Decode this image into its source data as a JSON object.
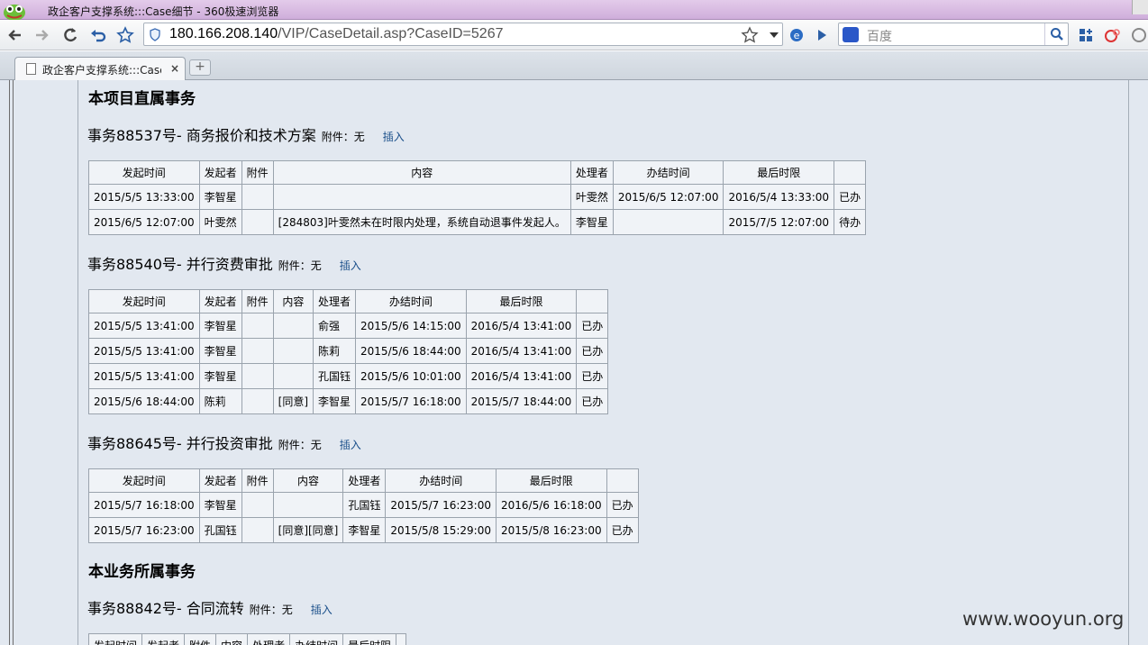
{
  "window": {
    "title": "政企客户支撑系统:::Case细节 - 360极速浏览器"
  },
  "browser": {
    "url_host": "180.166.208.140",
    "url_path": "/VIP/CaseDetail.asp?CaseID=5267",
    "search_placeholder": "百度",
    "tab_label": "政企客户支撑系统:::Case细节",
    "tab_close": "×",
    "new_tab": "+"
  },
  "content": {
    "section1_title": "本项目直属事务",
    "section2_title": "本业务所属事务",
    "attachment_prefix": "附件：",
    "insert_label": "插入",
    "tasks": [
      {
        "title": "事务88537号- 商务报价和技术方案",
        "attachment": "附件：无",
        "insert": "插入",
        "headers": [
          "发起时间",
          "发起者",
          "附件",
          "内容",
          "处理者",
          "办结时间",
          "最后时限",
          ""
        ],
        "rows": [
          [
            "2015/5/5 13:33:00",
            "李智星",
            "",
            "",
            "叶雯然",
            "2015/6/5 12:07:00",
            "2016/5/4 13:33:00",
            "已办"
          ],
          [
            "2015/6/5 12:07:00",
            "叶雯然",
            "",
            "[284803]叶雯然未在时限内处理，系统自动退事件发起人。",
            "李智星",
            "",
            "2015/7/5 12:07:00",
            "待办"
          ]
        ]
      },
      {
        "title": "事务88540号- 并行资费审批",
        "attachment": "附件：无",
        "insert": "插入",
        "headers": [
          "发起时间",
          "发起者",
          "附件",
          "内容",
          "处理者",
          "办结时间",
          "最后时限",
          ""
        ],
        "rows": [
          [
            "2015/5/5 13:41:00",
            "李智星",
            "",
            "",
            "俞强",
            "2015/5/6 14:15:00",
            "2016/5/4 13:41:00",
            "已办"
          ],
          [
            "2015/5/5 13:41:00",
            "李智星",
            "",
            "",
            "陈莉",
            "2015/5/6 18:44:00",
            "2016/5/4 13:41:00",
            "已办"
          ],
          [
            "2015/5/5 13:41:00",
            "李智星",
            "",
            "",
            "孔国钰",
            "2015/5/6 10:01:00",
            "2016/5/4 13:41:00",
            "已办"
          ],
          [
            "2015/5/6 18:44:00",
            "陈莉",
            "",
            "[同意]",
            "李智星",
            "2015/5/7 16:18:00",
            "2015/5/7 18:44:00",
            "已办"
          ]
        ]
      },
      {
        "title": "事务88645号- 并行投资审批",
        "attachment": "附件：无",
        "insert": "插入",
        "headers": [
          "发起时间",
          "发起者",
          "附件",
          "内容",
          "处理者",
          "办结时间",
          "最后时限",
          ""
        ],
        "rows": [
          [
            "2015/5/7 16:18:00",
            "李智星",
            "",
            "",
            "孔国钰",
            "2015/5/7 16:23:00",
            "2016/5/6 16:18:00",
            "已办"
          ],
          [
            "2015/5/7 16:23:00",
            "孔国钰",
            "",
            "[同意][同意]",
            "李智星",
            "2015/5/8 15:29:00",
            "2015/5/8 16:23:00",
            "已办"
          ]
        ]
      },
      {
        "title": "事务88842号- 合同流转",
        "attachment": "附件：无",
        "insert": "插入",
        "headers": [
          "发起时间",
          "发起者",
          "附件",
          "内容",
          "处理者",
          "办结时间",
          "最后时限",
          ""
        ],
        "rows": []
      }
    ]
  },
  "watermark": "www.wooyun.org",
  "colors": {
    "page_bg": "#e2e8f0",
    "link": "#1a4f8a",
    "title_bar": "#d9bde3"
  }
}
